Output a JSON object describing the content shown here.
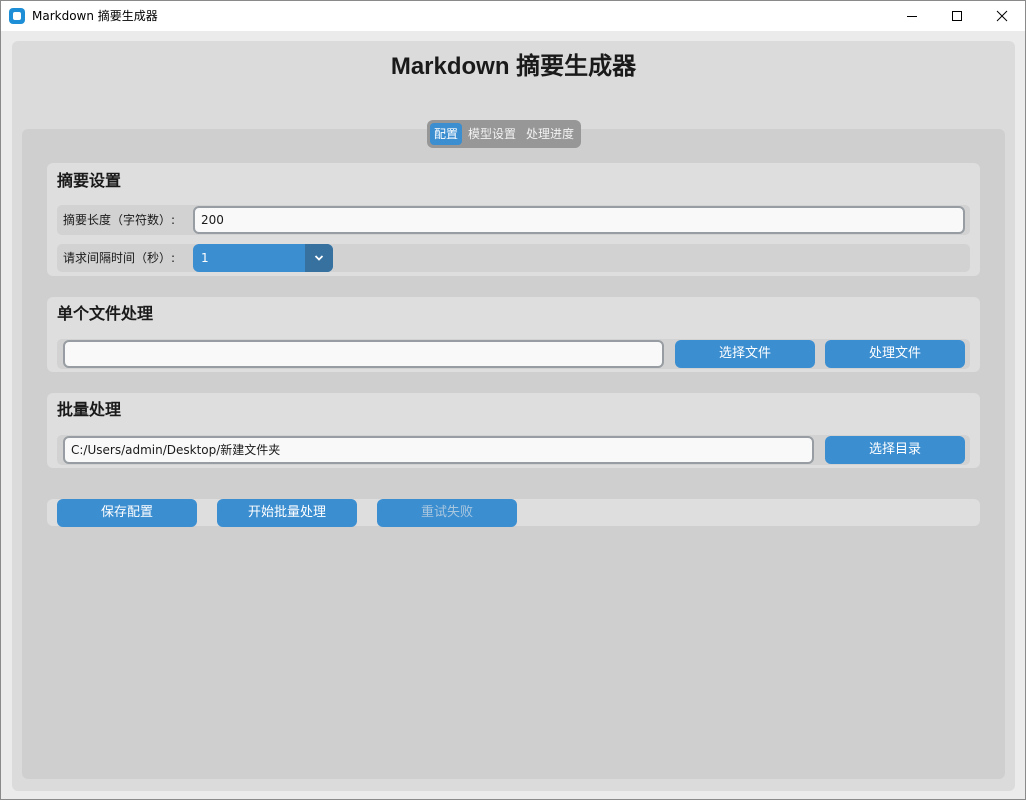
{
  "window": {
    "title": "Markdown 摘要生成器"
  },
  "app": {
    "heading": "Markdown 摘要生成器"
  },
  "tabs": [
    {
      "label": "配置",
      "active": true
    },
    {
      "label": "模型设置",
      "active": false
    },
    {
      "label": "处理进度",
      "active": false
    }
  ],
  "summary_settings": {
    "title": "摘要设置",
    "length_label": "摘要长度（字符数）:",
    "length_value": "200",
    "interval_label": "请求间隔时间（秒）:",
    "interval_value": "1"
  },
  "single_file": {
    "title": "单个文件处理",
    "path_value": "",
    "choose_button": "选择文件",
    "process_button": "处理文件"
  },
  "batch": {
    "title": "批量处理",
    "dir_value": "C:/Users/admin/Desktop/新建文件夹",
    "choose_dir_button": "选择目录"
  },
  "actions": {
    "save": "保存配置",
    "start_batch": "开始批量处理",
    "retry_failed": "重试失败",
    "retry_failed_enabled": false
  },
  "icons": {
    "app": "app-icon",
    "minimize": "minimize-icon",
    "maximize": "maximize-icon",
    "close": "close-icon",
    "dropdown": "chevron-down-icon"
  },
  "colors": {
    "accent": "#3b8ed0",
    "accent_dark": "#36719f",
    "panel": "#cfcfcf",
    "section": "#dedede"
  }
}
